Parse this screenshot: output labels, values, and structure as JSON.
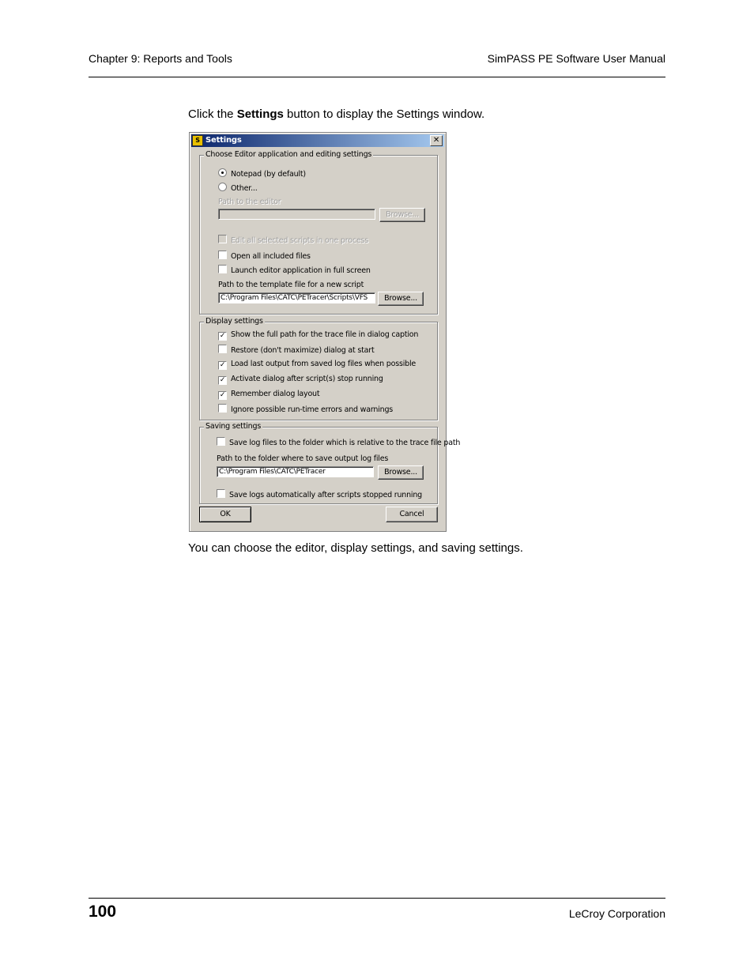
{
  "header": {
    "chapter": "Chapter 9: Reports and Tools",
    "manual": "SimPASS PE Software User Manual"
  },
  "intro": {
    "before": "Click the ",
    "bold": "Settings",
    "after": " button to display the Settings window."
  },
  "dialog": {
    "title": "Settings",
    "icon_text": "S",
    "close_glyph": "✕",
    "editor_group": {
      "legend": "Choose Editor application and editing settings",
      "radio_notepad": "Notepad (by default)",
      "radio_other": "Other...",
      "path_label": "Path to the editor",
      "path_value": "",
      "browse1": "Browse...",
      "cb_edit_all": "Edit all selected scripts in one process",
      "cb_open_included": "Open all included files",
      "cb_launch_full": "Launch editor application in full screen",
      "template_label": "Path to the template file for a new script",
      "template_value": "C:\\Program Files\\CATC\\PETracer\\Scripts\\VFS",
      "browse2": "Browse..."
    },
    "display_group": {
      "legend": "Display settings",
      "items": [
        {
          "label": "Show the full path for the trace file in dialog caption",
          "checked": "✓"
        },
        {
          "label": "Restore (don't maximize) dialog at start",
          "checked": ""
        },
        {
          "label": "Load last output from saved log files when possible",
          "checked": "✓"
        },
        {
          "label": "Activate dialog after script(s) stop running",
          "checked": "✓"
        },
        {
          "label": "Remember dialog layout",
          "checked": "✓"
        },
        {
          "label": "Ignore possible run-time errors and warnings",
          "checked": ""
        }
      ]
    },
    "saving_group": {
      "legend": "Saving settings",
      "cb_relative": "Save log files to the folder which is relative to the trace file path",
      "folder_label": "Path to the folder where to save output log files",
      "folder_value": "C:\\Program Files\\CATC\\PETracer",
      "browse3": "Browse...",
      "cb_auto_save": "Save logs automatically after scripts stopped running"
    },
    "ok": "OK",
    "cancel": "Cancel"
  },
  "outro": "You can choose the editor, display settings, and saving settings.",
  "footer": {
    "page_number": "100",
    "company": "LeCroy Corporation"
  }
}
